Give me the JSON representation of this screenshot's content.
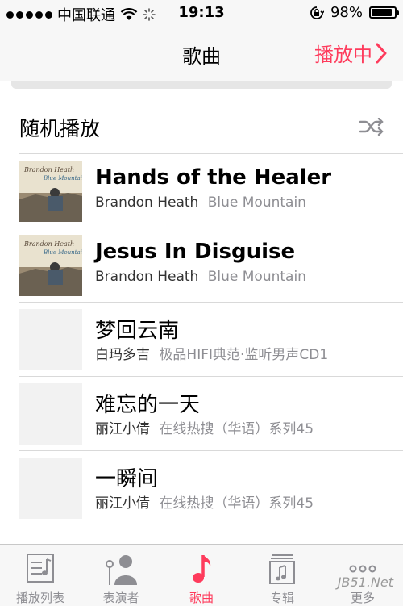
{
  "status_bar": {
    "carrier": "中国联通",
    "time": "19:13",
    "battery": "98%",
    "battery_level": 0.98,
    "signal_bars": 5
  },
  "nav": {
    "title": "歌曲",
    "now_playing": "播放中"
  },
  "shuffle": {
    "label": "随机播放",
    "icon": "shuffle-icon"
  },
  "songs": [
    {
      "title": "Hands of the Healer",
      "artist": "Brandon Heath",
      "album": "Blue Mountain",
      "has_art": true
    },
    {
      "title": "Jesus In Disguise",
      "artist": "Brandon Heath",
      "album": "Blue Mountain",
      "has_art": true
    },
    {
      "title": "梦回云南",
      "artist": "白玛多吉",
      "album": "极品HIFI典范·监听男声CD1",
      "has_art": false
    },
    {
      "title": "难忘的一天",
      "artist": "丽江小倩",
      "album": "在线热搜（华语）系列45",
      "has_art": false
    },
    {
      "title": "一瞬间",
      "artist": "丽江小倩",
      "album": "在线热搜（华语）系列45",
      "has_art": false
    }
  ],
  "tabs": [
    {
      "label": "播放列表",
      "icon": "playlist-icon",
      "active": false
    },
    {
      "label": "表演者",
      "icon": "artist-icon",
      "active": false
    },
    {
      "label": "歌曲",
      "icon": "music-note-icon",
      "active": true
    },
    {
      "label": "专辑",
      "icon": "album-icon",
      "active": false
    },
    {
      "label": "更多",
      "icon": "more-icon",
      "active": false
    }
  ],
  "watermark": "JB51.Net",
  "colors": {
    "accent": "#fe3b5c",
    "secondary_text": "#8e8e93"
  }
}
